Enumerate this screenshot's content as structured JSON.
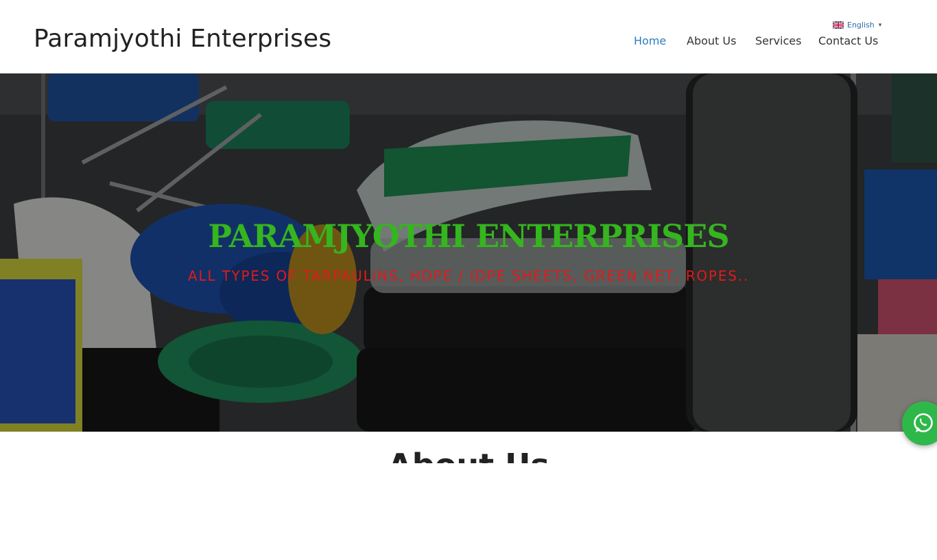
{
  "header": {
    "brand": "Paramjyothi Enterprises",
    "language": {
      "label": "English",
      "caret": "▾"
    },
    "nav": [
      {
        "label": "Home",
        "active": true
      },
      {
        "label": "About Us",
        "active": false
      },
      {
        "label": "Services",
        "active": false
      },
      {
        "label": "Contact Us",
        "active": false
      }
    ],
    "nav_active_color": "#2f7bbf"
  },
  "hero": {
    "title": "PARAMJYOTHI ENTERPRISES",
    "subtitle": "ALL TYPES OF TARPAULINS, HDPE / IDPE SHEETS, GREEN NET, ROPES..",
    "title_color": "#35b51e",
    "subtitle_color": "#e21a1a",
    "background_image": "warehouse-stock-photo"
  },
  "section": {
    "heading": "About Us"
  },
  "floating": {
    "icon": "whatsapp-icon",
    "color": "#2fb84a"
  }
}
